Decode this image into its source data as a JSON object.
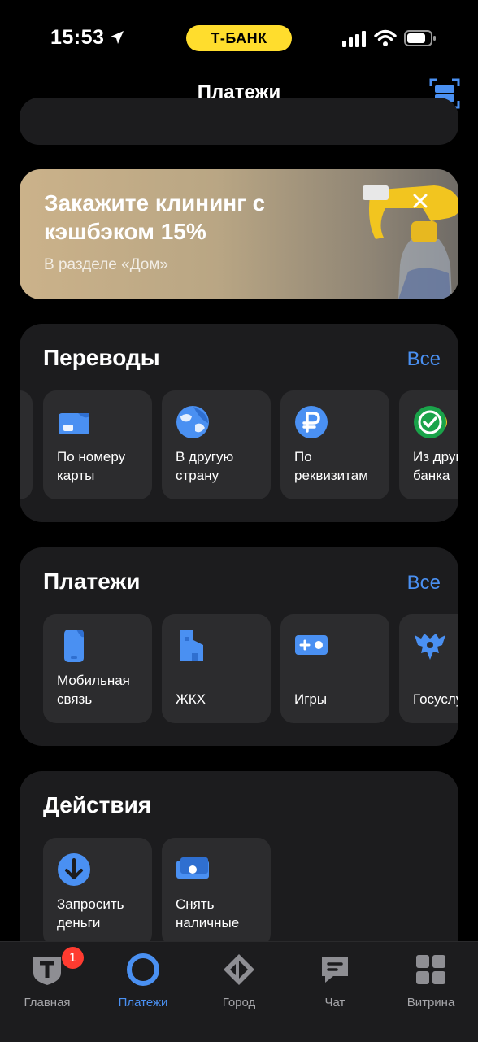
{
  "status_bar": {
    "time": "15:53",
    "brand": "Т‑БАНК"
  },
  "header": {
    "title": "Платежи"
  },
  "banner": {
    "title": "Закажите клининг с кэшбэком 15%",
    "subtitle": "В разделе «Дом»"
  },
  "transfers": {
    "title": "Переводы",
    "all_label": "Все",
    "items": [
      {
        "label": "По номеру\nкарты",
        "icon": "card-icon"
      },
      {
        "label": "В другую\nстрану",
        "icon": "globe-icon"
      },
      {
        "label": "По\nреквизитам",
        "icon": "ruble-icon"
      },
      {
        "label": "Из другого\nбанка",
        "icon": "sbp-check-icon"
      }
    ]
  },
  "payments": {
    "title": "Платежи",
    "all_label": "Все",
    "items": [
      {
        "label": "Мобильная\nсвязь",
        "icon": "phone-icon"
      },
      {
        "label": "ЖКХ",
        "icon": "house-icon"
      },
      {
        "label": "Игры",
        "icon": "gamepad-icon"
      },
      {
        "label": "Госуслуги",
        "icon": "eagle-icon"
      }
    ]
  },
  "actions": {
    "title": "Действия",
    "items": [
      {
        "label": "Запросить\nденьги",
        "icon": "arrow-down-icon"
      },
      {
        "label": "Снять\nналичные",
        "icon": "cash-icon"
      }
    ]
  },
  "tabbar": {
    "items": [
      {
        "label": "Главная",
        "badge": "1"
      },
      {
        "label": "Платежи",
        "active": true
      },
      {
        "label": "Город"
      },
      {
        "label": "Чат"
      },
      {
        "label": "Витрина"
      }
    ]
  },
  "colors": {
    "accent": "#4a90f2",
    "brand_yellow": "#ffdd2d",
    "card_bg": "#1c1c1e",
    "tile_bg": "#2c2c2e",
    "badge": "#ff3b30"
  }
}
